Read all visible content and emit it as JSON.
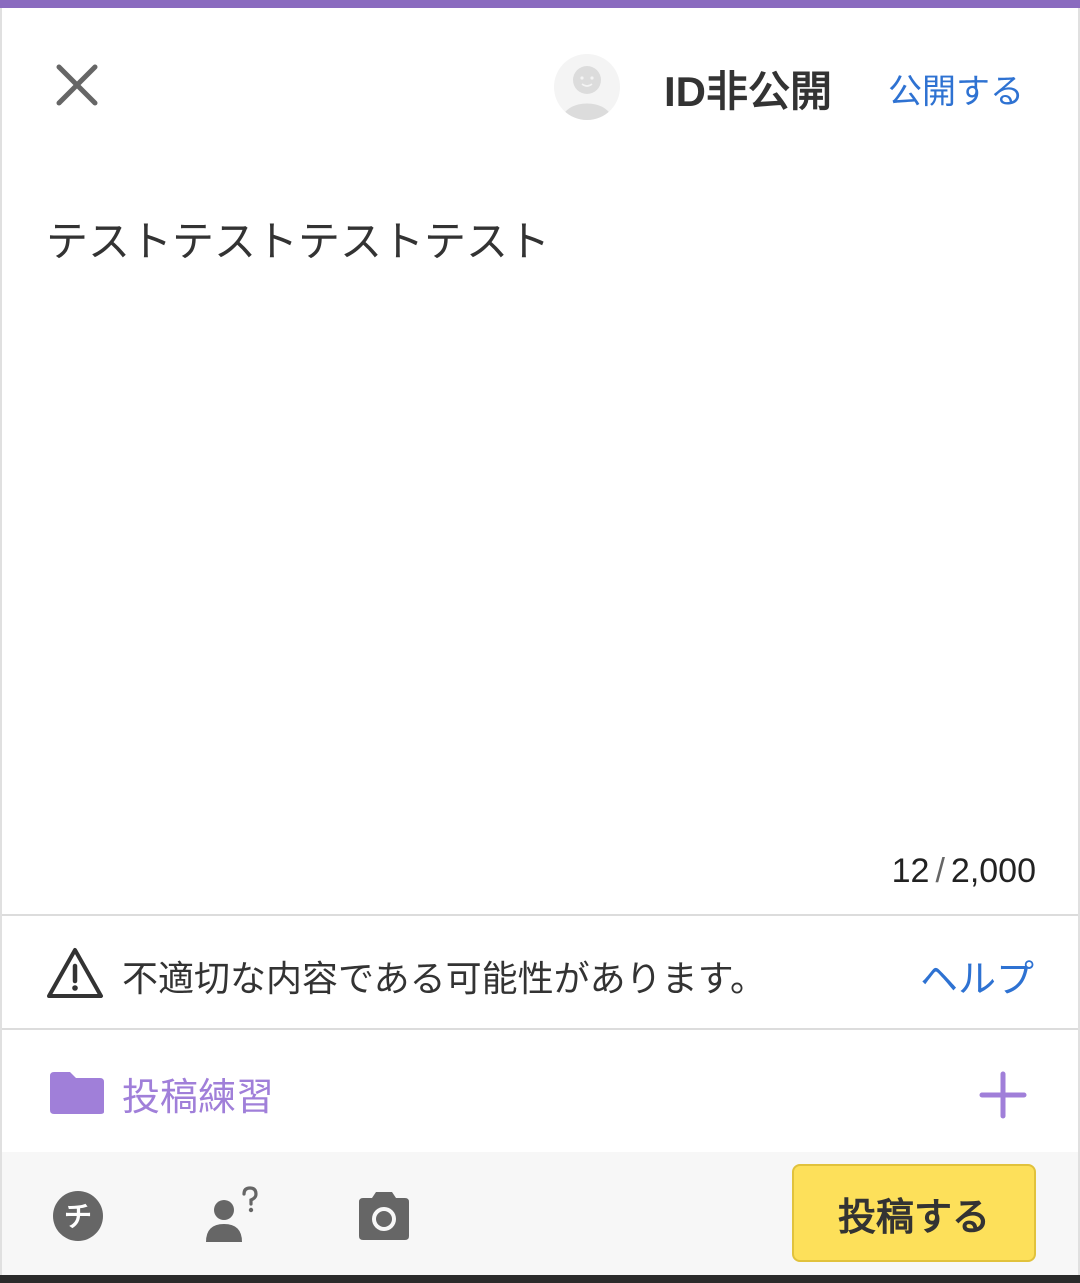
{
  "header": {
    "close_icon": "close-icon",
    "avatar_icon": "default-avatar-icon",
    "id_label": "ID非公開",
    "publish_link": "公開する"
  },
  "post": {
    "body_text": "テストテストテストテスト",
    "char_count": "12",
    "char_separator": "/",
    "char_limit": "2,000"
  },
  "warning": {
    "icon": "warning-icon",
    "text": "不適切な内容である可能性があります。",
    "help_link": "ヘルプ"
  },
  "category": {
    "icon": "folder-icon",
    "label": "投稿練習",
    "add_icon": "plus-icon"
  },
  "toolbar": {
    "chip_icon_label": "チ",
    "chip_icon": "chip-icon",
    "user_icon": "user-question-icon",
    "camera_icon": "camera-icon",
    "submit_label": "投稿する"
  },
  "colors": {
    "accent": "#8a6bbf",
    "link": "#2e72d2",
    "category": "#a07fd9",
    "submit_bg": "#fde05a"
  }
}
